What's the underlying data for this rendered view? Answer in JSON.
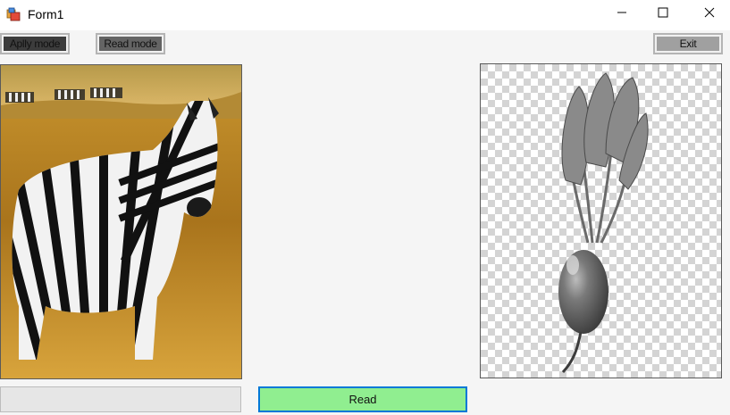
{
  "window": {
    "title": "Form1",
    "controls": {
      "minimize": "minimize-icon",
      "maximize": "maximize-icon",
      "close": "close-icon"
    }
  },
  "toolbar": {
    "apply_mode_label": "Aplly mode",
    "read_mode_label": "Read mode",
    "exit_label": "Exit"
  },
  "images": {
    "left": {
      "subject": "zebra-photo"
    },
    "right": {
      "subject": "beet-grayscale-transparent"
    }
  },
  "actions": {
    "read_label": "Read"
  },
  "colors": {
    "apply_mode_bg": "#3c3c3c",
    "read_mode_bg": "#646464",
    "exit_bg": "#a0a0a0",
    "read_bg": "#90ee90",
    "focus_border": "#0078d7",
    "client_bg": "#f5f5f5"
  }
}
